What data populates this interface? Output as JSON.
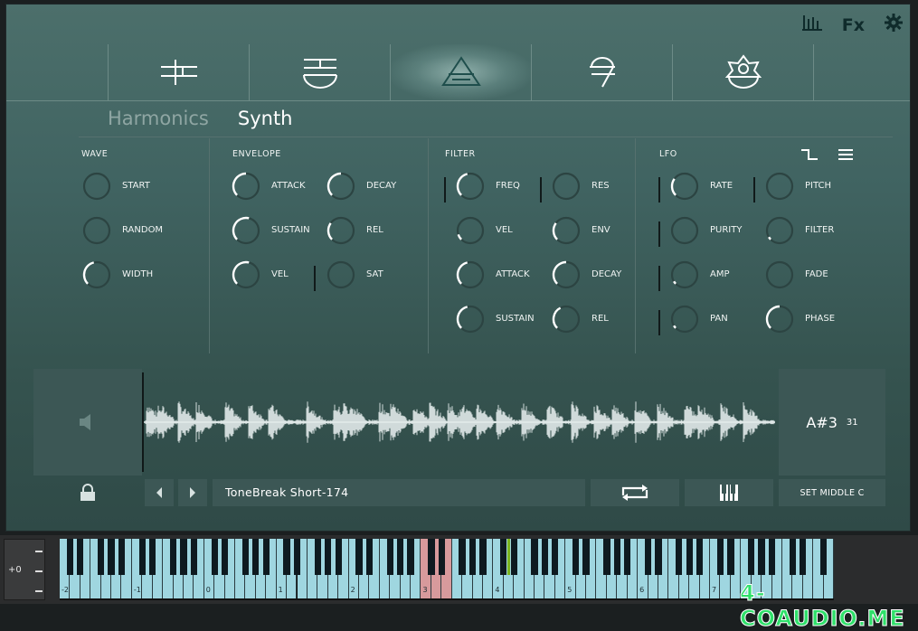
{
  "header": {
    "icons": [
      "mixer-icon",
      "fx-icon",
      "gear-icon"
    ],
    "fx_label": "Fx"
  },
  "tabs": [
    {
      "icon": "tab-symbol-1-icon",
      "active": false
    },
    {
      "icon": "tab-symbol-2-icon",
      "active": false
    },
    {
      "icon": "tab-symbol-3-icon",
      "active": true
    },
    {
      "icon": "tab-symbol-4-icon",
      "active": false
    },
    {
      "icon": "tab-symbol-5-icon",
      "active": false
    }
  ],
  "subtabs": [
    {
      "label": "Harmonics",
      "active": false
    },
    {
      "label": "Synth",
      "active": true
    }
  ],
  "sections": {
    "wave": {
      "title": "WAVE",
      "knobs": [
        {
          "label": "START",
          "value": 0.0
        },
        {
          "label": "RANDOM",
          "value": 0.0
        },
        {
          "label": "WIDTH",
          "value": 0.45
        }
      ]
    },
    "envelope": {
      "title": "ENVELOPE",
      "knobs": [
        {
          "label": "ATTACK",
          "value": 0.5
        },
        {
          "label": "DECAY",
          "value": 0.5
        },
        {
          "label": "SUSTAIN",
          "value": 0.55
        },
        {
          "label": "REL",
          "value": 0.3
        },
        {
          "label": "VEL",
          "value": 0.55
        },
        {
          "label": "SAT",
          "value": 0.0
        }
      ]
    },
    "filter": {
      "title": "FILTER",
      "knobs": [
        {
          "label": "FREQ",
          "value": 0.45
        },
        {
          "label": "RES",
          "value": 0.0
        },
        {
          "label": "VEL",
          "value": 0.1
        },
        {
          "label": "ENV",
          "value": 0.3
        },
        {
          "label": "ATTACK",
          "value": 0.45
        },
        {
          "label": "DECAY",
          "value": 0.5
        },
        {
          "label": "SUSTAIN",
          "value": 0.45
        },
        {
          "label": "REL",
          "value": 0.4
        }
      ]
    },
    "lfo": {
      "title": "LFO",
      "knobs": [
        {
          "label": "RATE",
          "value": 0.3
        },
        {
          "label": "PITCH",
          "value": 0.0
        },
        {
          "label": "PURITY",
          "value": 0.0
        },
        {
          "label": "FILTER",
          "value": 0.05
        },
        {
          "label": "AMP",
          "value": 0.05
        },
        {
          "label": "FADE",
          "value": 0.0
        },
        {
          "label": "PAN",
          "value": 0.05
        },
        {
          "label": "PHASE",
          "value": 0.5
        }
      ]
    }
  },
  "lfo_icons": [
    "square-wave-icon",
    "menu-icon"
  ],
  "sample": {
    "name": "ToneBreak Short-174",
    "note": "A#3",
    "note_number": "31",
    "set_middle_label": "SET MIDDLE C"
  },
  "keyboard": {
    "octave_shift": "+0",
    "octave_labels": [
      "-2",
      "-1",
      "0",
      "1",
      "2",
      "3",
      "4",
      "5",
      "6",
      "7"
    ],
    "highlighted_keys": [
      35,
      36,
      37
    ]
  },
  "watermark": "4-COAUDIO.ME",
  "colors": {
    "panel_bg": "#406361",
    "knob_arc": "#ffffff",
    "key_white": "#9fd6e0",
    "key_highlight": "#d79a9c"
  }
}
